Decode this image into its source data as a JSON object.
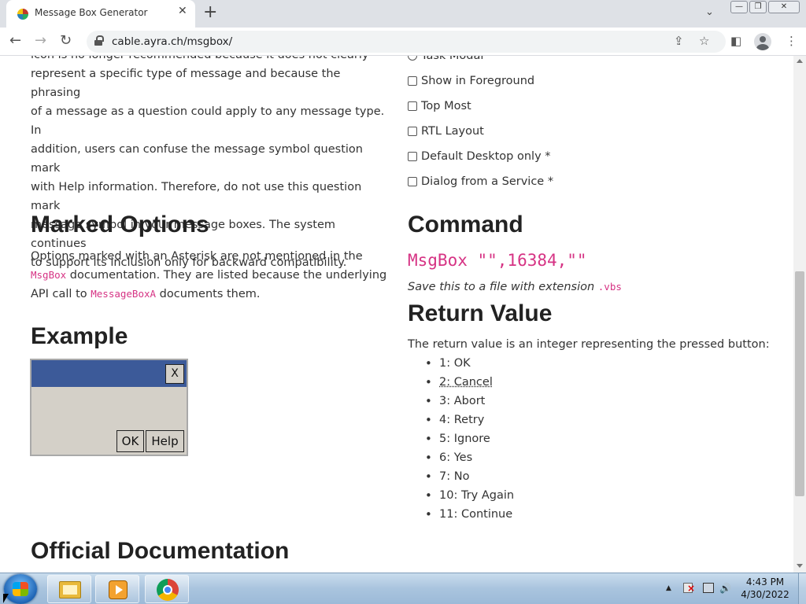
{
  "browser": {
    "tab_title": "Message Box Generator",
    "tab_close": "✕",
    "new_tab": "+",
    "url": "cable.ayra.ch/msgbox/",
    "window_buttons": [
      "—",
      "❐",
      "✕"
    ]
  },
  "left": {
    "intro_lines": [
      "icon is no longer recommended because it does not clearly",
      "represent a specific type of message and because the phrasing",
      "of a message as a question could apply to any message type. In",
      "addition, users can confuse the message symbol question mark",
      "with Help information. Therefore, do not use this question mark",
      "message symbol in your message boxes. The system continues",
      "to support its inclusion only for backward compatibility."
    ],
    "marked_options": {
      "heading": "Marked Options",
      "p1_a": "Options marked with an Asterisk are not mentioned in the",
      "code1": "MsgBox",
      "p1_b": " documentation. They are listed because the underlying",
      "p2_a": "API call to ",
      "code2": "MessageBoxA",
      "p2_b": " documents them."
    },
    "example": {
      "heading": "Example",
      "close": "X",
      "buttons": [
        "OK",
        "Help"
      ]
    },
    "official_docs_heading": "Official Documentation"
  },
  "right": {
    "options": [
      {
        "label": "Task Modal",
        "type": "radio"
      },
      {
        "label": "Show in Foreground",
        "type": "checkbox"
      },
      {
        "label": "Top Most",
        "type": "checkbox"
      },
      {
        "label": "RTL Layout",
        "type": "checkbox"
      },
      {
        "label": "Default Desktop only *",
        "type": "checkbox"
      },
      {
        "label": "Dialog from a Service *",
        "type": "checkbox"
      }
    ],
    "command": {
      "heading": "Command",
      "code": "MsgBox \"\",16384,\"\"",
      "save_text": "Save this to a file with extension ",
      "ext": ".vbs"
    },
    "return_value": {
      "heading": "Return Value",
      "description": "The return value is an integer representing the pressed button:",
      "items": [
        "1: OK",
        "2: Cancel",
        "3: Abort",
        "4: Retry",
        "5: Ignore",
        "6: Yes",
        "7: No",
        "10: Try Again",
        "11: Continue"
      ]
    }
  },
  "taskbar": {
    "time": "4:43 PM",
    "date": "4/30/2022",
    "tray_arrow": "▲",
    "volume": "🔊"
  },
  "colors": {
    "code": "#d63384",
    "dialog_title": "#3c5a99",
    "dialog_body": "#d4d0c8"
  }
}
